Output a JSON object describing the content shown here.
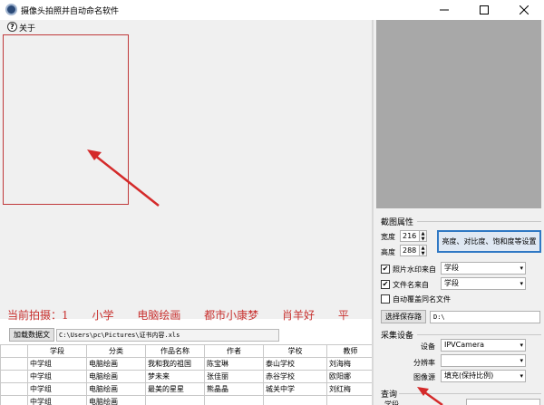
{
  "window": {
    "title": "摄像头拍照并自动命名软件"
  },
  "menu": {
    "about": "关于",
    "help_icon": "?"
  },
  "status": {
    "prefix": "当前拍摄：1",
    "items": [
      "小学",
      "电脑绘画",
      "都市小康梦",
      "肖羊好",
      "平"
    ]
  },
  "file": {
    "load_button": "加载数据文",
    "path": "C:\\Users\\pc\\Pictures\\证书内容.xls"
  },
  "table": {
    "headers": [
      "",
      "学段",
      "分类",
      "作品名称",
      "作者",
      "学校",
      "教师"
    ],
    "rows": [
      [
        "",
        "中学组",
        "电脑绘画",
        "我和我的祖国",
        "陈宝琳",
        "泰山学校",
        "刘海梅"
      ],
      [
        "",
        "中学组",
        "电脑绘画",
        "梦未来",
        "张佳丽",
        "赤谷学校",
        "欧阳娜"
      ],
      [
        "",
        "中学组",
        "电脑绘画",
        "最美的星星",
        "熊晶晶",
        "城关中学",
        "刘红梅"
      ],
      [
        "",
        "中学组",
        "电脑绘画",
        "",
        "",
        "",
        ""
      ]
    ]
  },
  "image_props": {
    "group_label": "截图属性",
    "width_label": "宽度",
    "width_value": "216",
    "height_label": "高度",
    "height_value": "288",
    "settings_button": "亮度、对比度、饱和度等设置",
    "watermark_label": "照片水印来自",
    "watermark_checked": true,
    "watermark_value": "学段",
    "filename_label": "文件名来自",
    "filename_checked": true,
    "filename_value": "学段",
    "overwrite_label": "自动覆盖同名文件",
    "overwrite_checked": false,
    "save_path_button": "选择保存路",
    "save_path": "D:\\"
  },
  "capture": {
    "group_label": "采集设备",
    "device_label": "设备",
    "device_value": "IPVCamera",
    "resolution_label": "分辨率",
    "resolution_value": "",
    "source_label": "图像源",
    "source_value": "填充(保持比例)"
  },
  "query": {
    "group_label": "查询",
    "field_label": "学段"
  },
  "colors": {
    "status_text": "#c8312f",
    "selection_border": "#c0393b",
    "arrow": "#d42a2a",
    "accent_button_border": "#2f78c4"
  }
}
